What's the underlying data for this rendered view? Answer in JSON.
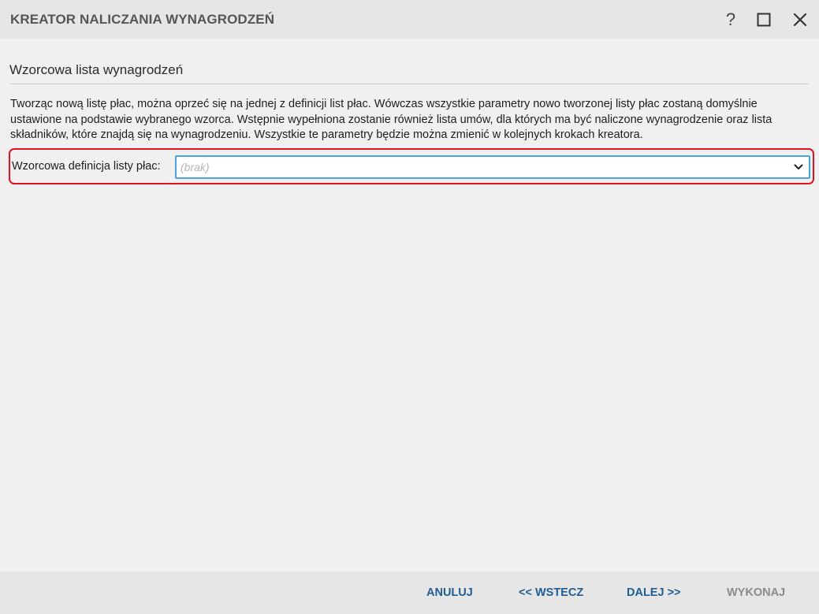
{
  "window": {
    "title": "KREATOR NALICZANIA WYNAGRODZEŃ",
    "help_label": "?"
  },
  "section": {
    "title": "Wzorcowa lista wynagrodzeń",
    "description": "Tworząc nową listę płac, można oprzeć się na jednej z definicji list płac. Wówczas wszystkie parametry nowo tworzonej listy płac zostaną domyślnie ustawione na podstawie wybranego wzorca. Wstępnie wypełniona zostanie również lista umów, dla których ma być naliczone wynagrodzenie oraz lista składników, które znajdą się na wynagrodzeniu. Wszystkie te parametry będzie można zmienić w kolejnych krokach kreatora."
  },
  "field": {
    "label": "Wzorcowa definicja listy płac:",
    "value": "",
    "placeholder": "(brak)"
  },
  "footer": {
    "cancel_label": "ANULUJ",
    "back_label": "<< WSTECZ",
    "next_label": "DALEJ >>",
    "execute_label": "WYKONAJ"
  },
  "colors": {
    "link_blue": "#1f5d94",
    "disabled_gray": "#8a8a8a",
    "highlight_red": "#e0141e",
    "focus_blue": "#4aa3df"
  },
  "icons": {
    "help": "question-mark-icon",
    "maximize": "maximize-icon",
    "close": "close-icon",
    "dropdown": "chevron-down-icon"
  }
}
